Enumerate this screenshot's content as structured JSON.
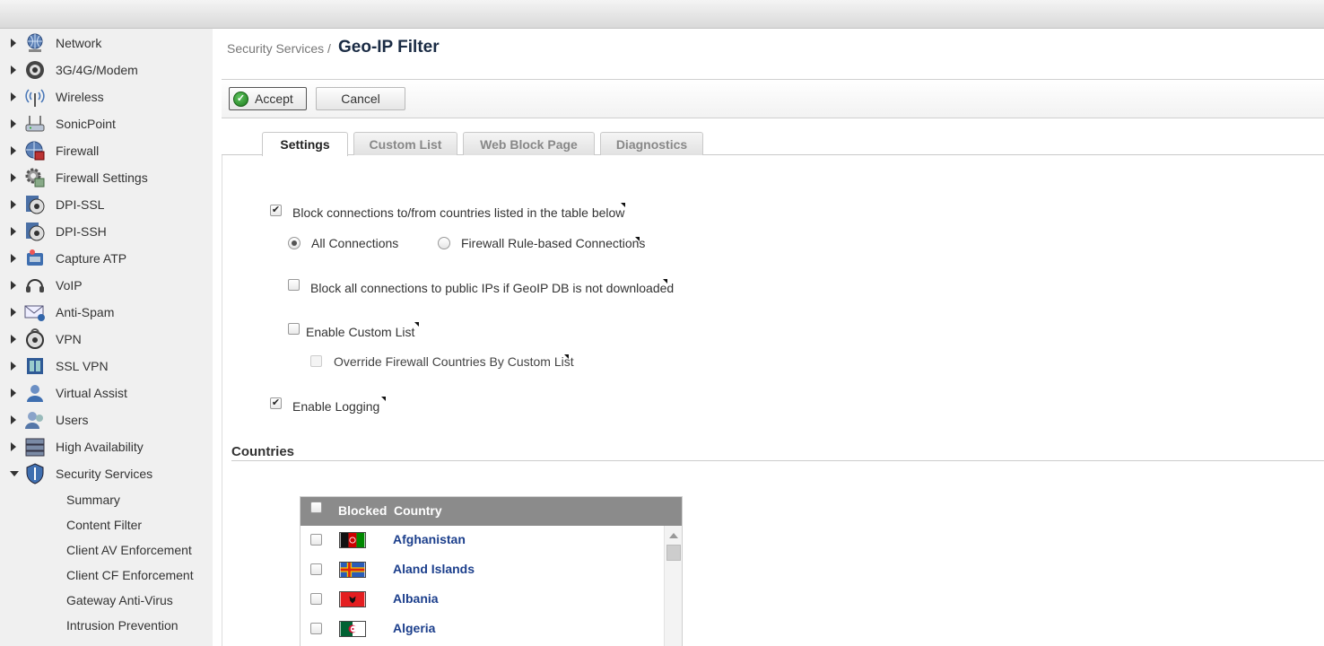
{
  "sidebar": {
    "items": [
      {
        "label": "Network",
        "icon": "globe-network-icon"
      },
      {
        "label": "3G/4G/Modem",
        "icon": "modem-icon"
      },
      {
        "label": "Wireless",
        "icon": "wireless-antenna-icon"
      },
      {
        "label": "SonicPoint",
        "icon": "access-point-icon"
      },
      {
        "label": "Firewall",
        "icon": "firewall-globe-icon"
      },
      {
        "label": "Firewall Settings",
        "icon": "firewall-settings-gear-icon"
      },
      {
        "label": "DPI-SSL",
        "icon": "dpi-ssl-lock-icon"
      },
      {
        "label": "DPI-SSH",
        "icon": "dpi-ssh-lock-icon"
      },
      {
        "label": "Capture ATP",
        "icon": "capture-atp-icon"
      },
      {
        "label": "VoIP",
        "icon": "headset-icon"
      },
      {
        "label": "Anti-Spam",
        "icon": "envelope-icon"
      },
      {
        "label": "VPN",
        "icon": "vpn-lock-icon"
      },
      {
        "label": "SSL VPN",
        "icon": "ssl-vpn-icon"
      },
      {
        "label": "Virtual Assist",
        "icon": "virtual-assist-user-icon"
      },
      {
        "label": "Users",
        "icon": "users-icon"
      },
      {
        "label": "High Availability",
        "icon": "servers-icon"
      },
      {
        "label": "Security Services",
        "icon": "shield-icon"
      }
    ],
    "sub_items": [
      {
        "label": "Summary"
      },
      {
        "label": "Content Filter"
      },
      {
        "label": "Client AV Enforcement"
      },
      {
        "label": "Client CF Enforcement"
      },
      {
        "label": "Gateway Anti-Virus"
      },
      {
        "label": "Intrusion Prevention"
      }
    ]
  },
  "header": {
    "breadcrumb": "Security Services /",
    "title": "Geo-IP Filter"
  },
  "toolbar": {
    "accept_label": "Accept",
    "cancel_label": "Cancel"
  },
  "tabs": [
    {
      "label": "Settings",
      "active": true
    },
    {
      "label": "Custom List",
      "active": false
    },
    {
      "label": "Web Block Page",
      "active": false
    },
    {
      "label": "Diagnostics",
      "active": false
    }
  ],
  "settings": {
    "block_connections": {
      "label": "Block connections to/from countries listed in the table below",
      "checked": true
    },
    "all_connections": {
      "label": "All Connections",
      "selected": true
    },
    "firewall_rule_based": {
      "label": "Firewall Rule-based Connections",
      "selected": false
    },
    "block_public_ips": {
      "label": "Block all connections to public IPs if GeoIP DB is not downloaded",
      "checked": false
    },
    "enable_custom_list": {
      "label": "Enable Custom List",
      "checked": false
    },
    "override_firewall": {
      "label": "Override Firewall Countries By Custom List",
      "checked": false,
      "disabled": true
    },
    "enable_logging": {
      "label": "Enable Logging",
      "checked": true
    }
  },
  "countries": {
    "section_title": "Countries",
    "header_blocked": "Blocked",
    "header_country": "Country",
    "rows": [
      {
        "name": "Afghanistan",
        "blocked": false,
        "flag": "afghanistan-flag-icon"
      },
      {
        "name": "Aland Islands",
        "blocked": false,
        "flag": "aland-islands-flag-icon"
      },
      {
        "name": "Albania",
        "blocked": false,
        "flag": "albania-flag-icon"
      },
      {
        "name": "Algeria",
        "blocked": false,
        "flag": "algeria-flag-icon"
      }
    ]
  },
  "colors": {
    "title": "#1a2b44",
    "country_link": "#1c3f8c",
    "table_header": "#8b8b8b",
    "sidebar_bg": "#f0f0f0"
  }
}
